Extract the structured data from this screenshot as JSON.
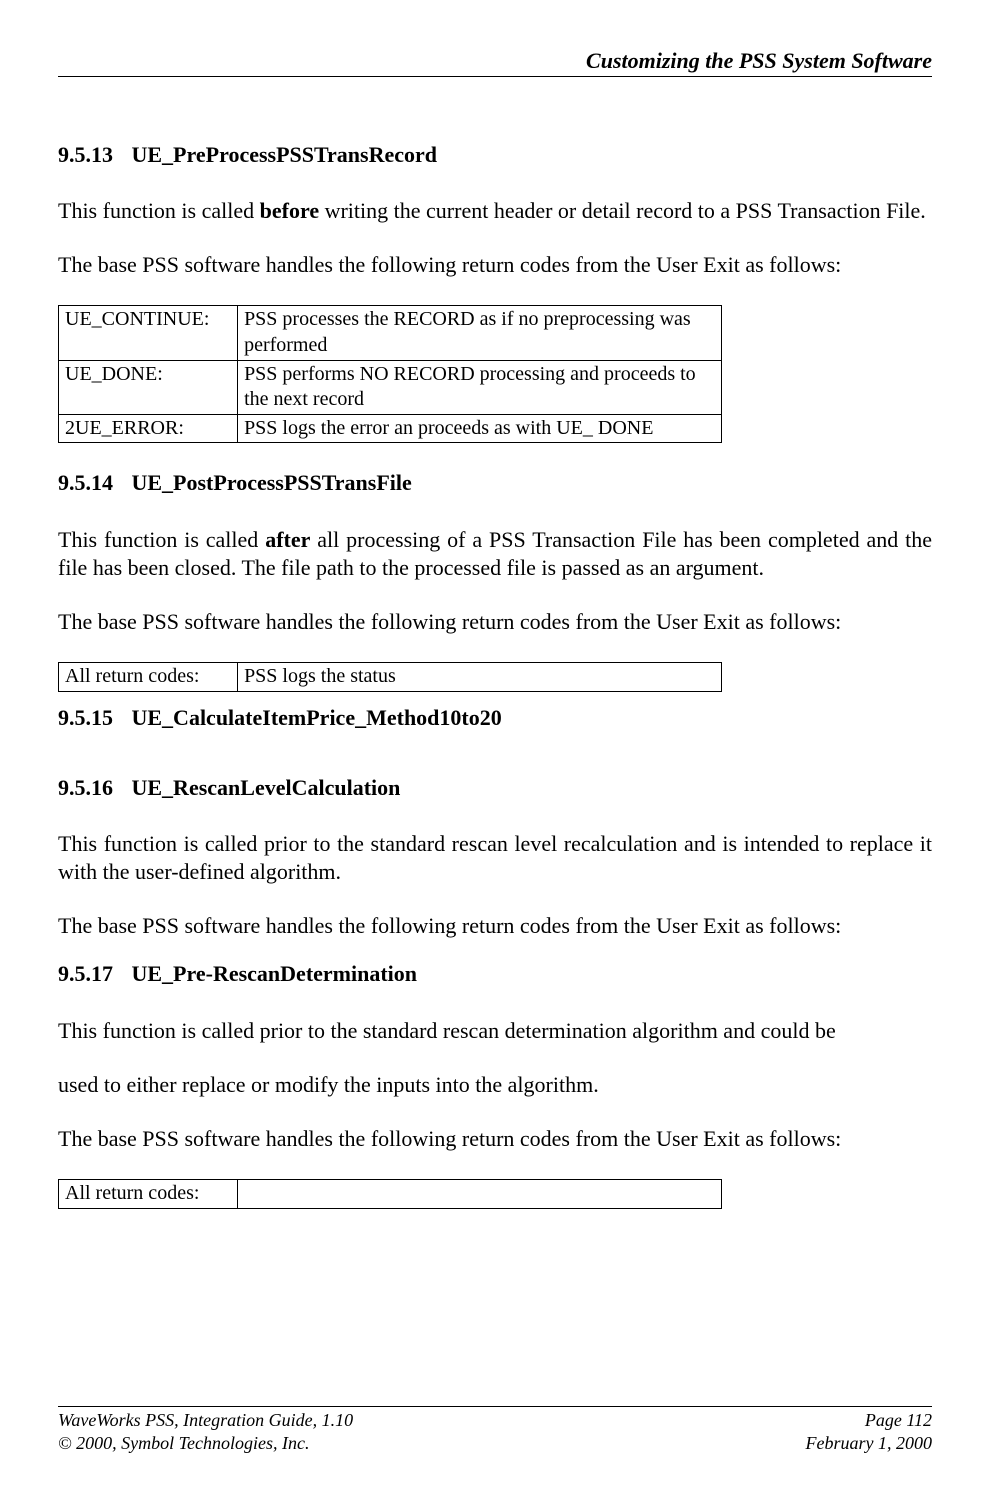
{
  "header": {
    "title": "Customizing the PSS System Software"
  },
  "sections": {
    "s9513": {
      "number": "9.5.13",
      "title": "UE_PreProcessPSSTransRecord",
      "para1_a": "This function is called ",
      "para1_bold": "before",
      "para1_b": " writing the current header or detail record to a PSS Transaction File.",
      "para2": "The base PSS software handles the following return codes from the User Exit as follows:",
      "table": [
        {
          "code": "UE_CONTINUE:",
          "desc": "PSS processes the RECORD as if no preprocessing was performed"
        },
        {
          "code": "UE_DONE:",
          "desc": "PSS performs NO RECORD processing and proceeds to the next record"
        },
        {
          "code": "2UE_ERROR:",
          "desc": "PSS logs the error an proceeds as with UE_ DONE"
        }
      ]
    },
    "s9514": {
      "number": "9.5.14",
      "title": "UE_PostProcessPSSTransFile",
      "para1_a": "This function is called ",
      "para1_bold": "after",
      "para1_b": " all processing of a PSS Transaction File has been completed and the file has been closed.  The file path to the processed file is passed as an argument.",
      "para2": "The base PSS software handles the following return codes from the User Exit as follows:",
      "table": [
        {
          "code": "All return codes:",
          "desc": "PSS logs the status"
        }
      ]
    },
    "s9515": {
      "number": "9.5.15",
      "title": "UE_CalculateItemPrice_Method10to20"
    },
    "s9516": {
      "number": "9.5.16",
      "title": "UE_RescanLevelCalculation",
      "para1": "This function is called prior to the standard rescan level recalculation and is intended to replace it with the user-defined algorithm.",
      "para2": "The base PSS software handles the following return codes from the User Exit as follows:"
    },
    "s9517": {
      "number": "9.5.17",
      "title": "UE_Pre-RescanDetermination",
      "para1": "This function is called prior to the standard rescan determination algorithm and could be",
      "para2": "used to either replace or modify the inputs into the algorithm.",
      "para3": "The base PSS software handles the following return codes from the User Exit as follows:",
      "table": [
        {
          "code": "All return codes:",
          "desc": ""
        }
      ]
    }
  },
  "footer": {
    "left1": "WaveWorks PSS, Integration Guide, 1.10",
    "left2": "© 2000, Symbol Technologies, Inc.",
    "right1": "Page 112",
    "right2": "February 1, 2000"
  }
}
